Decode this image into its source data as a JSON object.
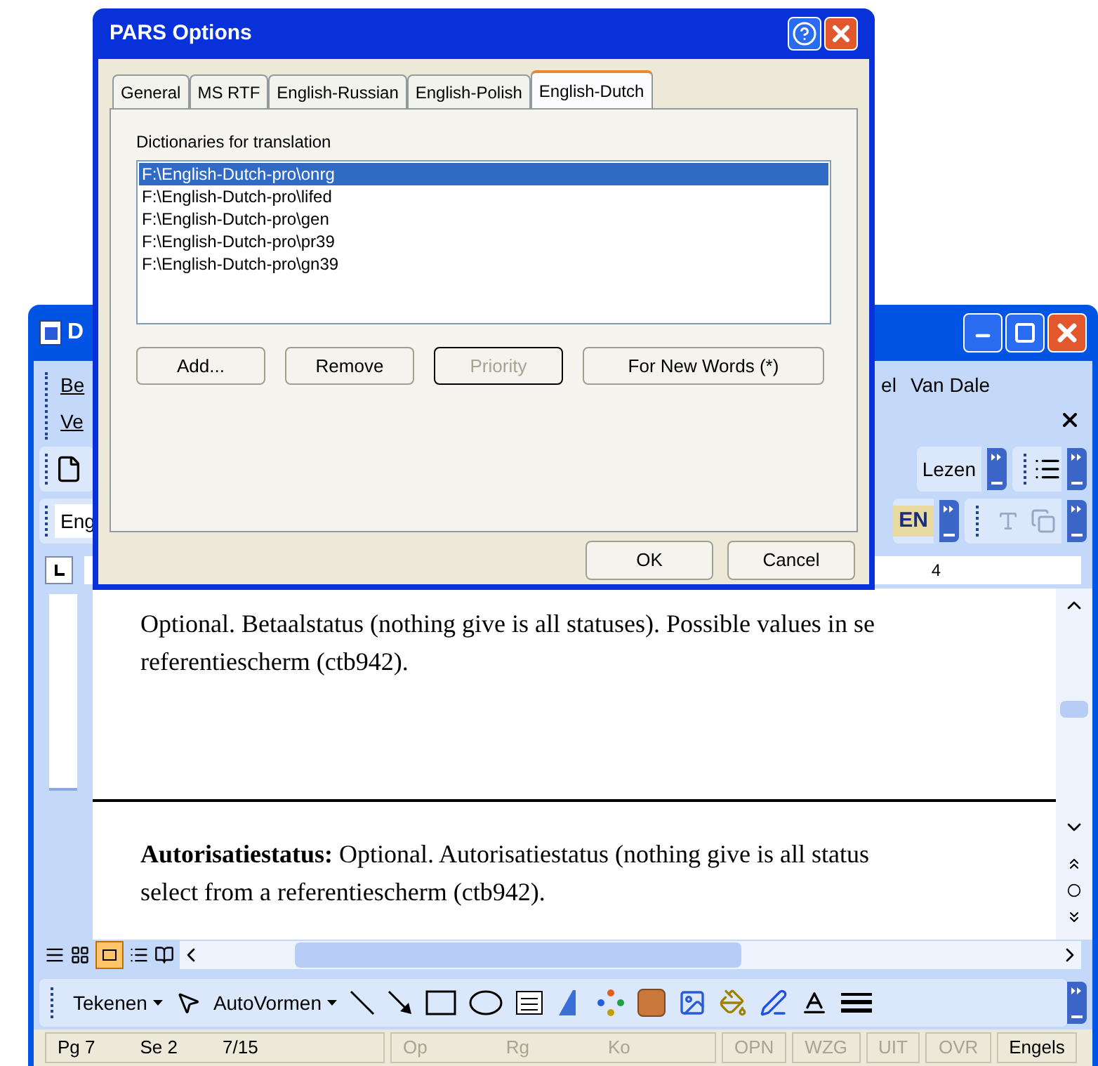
{
  "dialog": {
    "title": "PARS Options",
    "tabs": [
      {
        "label": "General",
        "selected": false
      },
      {
        "label": "MS RTF",
        "selected": false
      },
      {
        "label": "English-Russian",
        "selected": false
      },
      {
        "label": "English-Polish",
        "selected": false
      },
      {
        "label": "English-Dutch",
        "selected": true
      }
    ],
    "list_label": "Dictionaries for translation",
    "dictionaries": [
      {
        "path": "F:\\English-Dutch-pro\\onrg",
        "selected": true
      },
      {
        "path": "F:\\English-Dutch-pro\\lifed",
        "selected": false
      },
      {
        "path": "F:\\English-Dutch-pro\\gen",
        "selected": false
      },
      {
        "path": "F:\\English-Dutch-pro\\pr39",
        "selected": false
      },
      {
        "path": "F:\\English-Dutch-pro\\gn39",
        "selected": false
      }
    ],
    "actions": [
      {
        "label": "Add...",
        "disabled": false
      },
      {
        "label": "Remove",
        "disabled": false
      },
      {
        "label": "Priority",
        "disabled": true
      },
      {
        "label": "For New Words (*)",
        "disabled": false
      }
    ],
    "footer_buttons": [
      "OK",
      "Cancel"
    ]
  },
  "word": {
    "title": "D",
    "menu_left": [
      "Be",
      "Ve"
    ],
    "menu_right": [
      "el",
      "Van Dale"
    ],
    "read_button": "Lezen",
    "font_field": "Eng",
    "language_badge": "EN",
    "ruler_mark": "4",
    "paragraphs": [
      {
        "lines": [
          "Optional. Betaalstatus (nothing give is all statuses). Possible values in se",
          "referentiescherm (ctb942)."
        ]
      },
      {
        "lines": [
          "**Autorisatiestatus:** Optional. Autorisatiestatus (nothing give is all status",
          "select from a referentiescherm (ctb942)."
        ]
      }
    ],
    "draw_menu": "Tekenen",
    "shapes_menu": "AutoVormen",
    "status_bar": [
      {
        "items": [
          {
            "text": "Pg 7",
            "dimmed": false
          },
          {
            "text": "Se 2",
            "dimmed": false
          },
          {
            "text": "7/15",
            "dimmed": false
          }
        ]
      },
      {
        "items": [
          {
            "text": "Op",
            "dimmed": true
          },
          {
            "text": "Rg",
            "dimmed": true
          },
          {
            "text": "Ko",
            "dimmed": true
          }
        ]
      },
      {
        "items": [
          {
            "text": "OPN",
            "dimmed": true
          }
        ]
      },
      {
        "items": [
          {
            "text": "WZG",
            "dimmed": true
          }
        ]
      },
      {
        "items": [
          {
            "text": "UIT",
            "dimmed": true
          }
        ]
      },
      {
        "items": [
          {
            "text": "OVR",
            "dimmed": true
          }
        ]
      },
      {
        "items": [
          {
            "text": "Engels",
            "dimmed": false
          }
        ]
      }
    ]
  }
}
